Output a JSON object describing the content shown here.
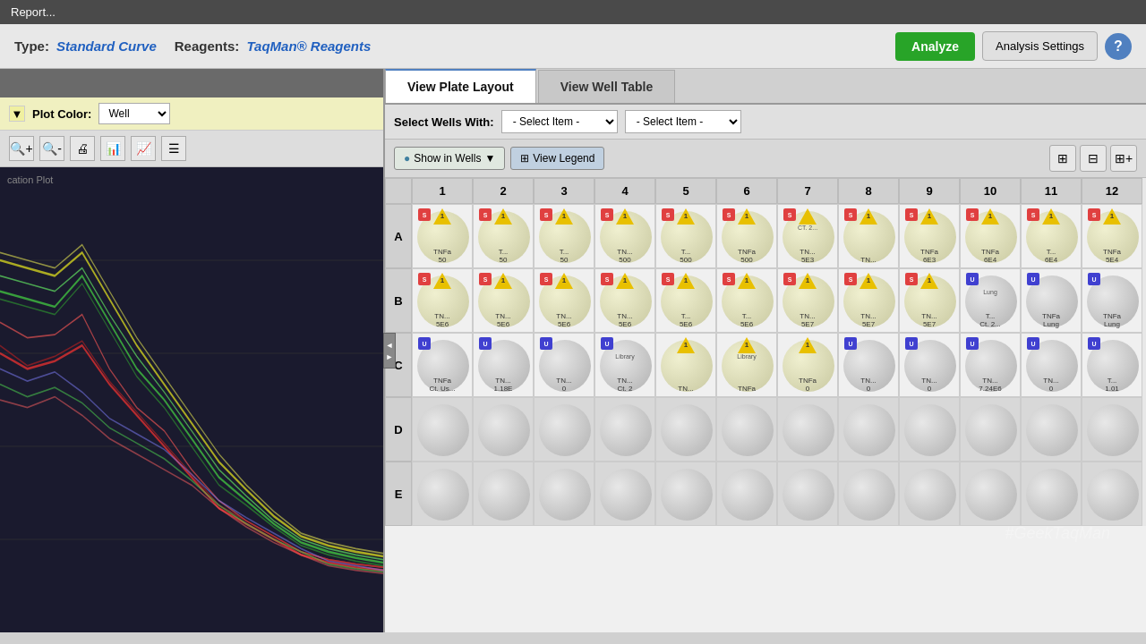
{
  "title_bar": {
    "label": "Report..."
  },
  "top_bar": {
    "type_label": "Type:",
    "type_value": "Standard Curve",
    "reagents_label": "Reagents:",
    "reagents_value": "TaqMan® Reagents",
    "analyze_btn": "Analyze",
    "analysis_settings_btn": "Analysis Settings",
    "help_btn": "?"
  },
  "left_panel": {
    "plot_color_label": "Plot Color:",
    "plot_color_value": "Well",
    "chart_label": "cation Plot"
  },
  "tabs": [
    {
      "id": "plate-layout",
      "label": "View Plate Layout",
      "active": true
    },
    {
      "id": "well-table",
      "label": "View Well Table",
      "active": false
    }
  ],
  "wells_toolbar": {
    "select_wells_label": "Select Wells With:",
    "dropdown1_label": "- Select Item -",
    "dropdown2_label": "- Select Item -"
  },
  "plate_toolbar": {
    "show_in_wells_label": "Show in Wells",
    "view_legend_label": "View Legend"
  },
  "plate": {
    "columns": [
      "1",
      "2",
      "3",
      "4",
      "5",
      "6",
      "7",
      "8",
      "9",
      "10",
      "11",
      "12"
    ],
    "rows": [
      "A",
      "B",
      "C",
      "D",
      "E"
    ],
    "row_A": [
      {
        "num": "1",
        "badge": "S",
        "text": "TNFa\n50",
        "type": "yellow"
      },
      {
        "num": "1",
        "badge": "S",
        "text": "T...\n50",
        "type": "yellow"
      },
      {
        "num": "1",
        "badge": "S",
        "text": "T...\n50",
        "type": "yellow"
      },
      {
        "num": "1",
        "badge": "S",
        "text": "TN...\n500",
        "type": "yellow"
      },
      {
        "num": "1",
        "badge": "S",
        "text": "T...\n500",
        "type": "yellow"
      },
      {
        "num": "1",
        "badge": "S",
        "text": "TNFa\n500",
        "type": "yellow"
      },
      {
        "num": "",
        "badge": "S",
        "text": "TN...\n5E3",
        "type": "special",
        "extra": "CT. 2..."
      },
      {
        "num": "1",
        "badge": "S",
        "text": "TN...\n",
        "type": "yellow"
      },
      {
        "num": "1",
        "badge": "S",
        "text": "TNFa\n6E3",
        "type": "yellow"
      },
      {
        "num": "1",
        "badge": "S",
        "text": "TNFa\n6E4",
        "type": "yellow"
      },
      {
        "num": "1",
        "badge": "S",
        "text": "T...\n6E4",
        "type": "yellow"
      },
      {
        "num": "1",
        "badge": "S",
        "text": "TNFa\n5E4",
        "type": "yellow"
      }
    ],
    "row_B": [
      {
        "num": "1",
        "badge": "S",
        "text": "TN...\n5E6",
        "type": "yellow"
      },
      {
        "num": "1",
        "badge": "S",
        "text": "TN...\n5E6",
        "type": "yellow"
      },
      {
        "num": "1",
        "badge": "S",
        "text": "TN...\n5E6",
        "type": "yellow"
      },
      {
        "num": "1",
        "badge": "S",
        "text": "TN...\n5E6",
        "type": "yellow"
      },
      {
        "num": "1",
        "badge": "S",
        "text": "T...\n5E6",
        "type": "yellow"
      },
      {
        "num": "1",
        "badge": "S",
        "text": "T...\n5E6",
        "type": "yellow"
      },
      {
        "num": "1",
        "badge": "S",
        "text": "TN...\n5E7",
        "type": "yellow"
      },
      {
        "num": "1",
        "badge": "S",
        "text": "TN...\n5E7",
        "type": "yellow"
      },
      {
        "num": "1",
        "badge": "S",
        "text": "TN...\n5E7",
        "type": "yellow"
      },
      {
        "num": "",
        "badge": "U",
        "text": "T...\nCt. 2...",
        "type": "gray",
        "extra": "Lung"
      },
      {
        "num": "",
        "badge": "U",
        "text": "TNFa\nLung",
        "type": "gray"
      },
      {
        "num": "",
        "badge": "U",
        "text": "TNFa\nLung",
        "type": "gray"
      }
    ],
    "row_C": [
      {
        "num": "",
        "badge": "U",
        "text": "TNFa\nCt. Us...",
        "type": "gray",
        "extra": ""
      },
      {
        "num": "",
        "badge": "U",
        "text": "TN...\n1.18E",
        "type": "gray"
      },
      {
        "num": "",
        "badge": "U",
        "text": "TN...\n0",
        "type": "gray"
      },
      {
        "num": "",
        "badge": "U",
        "text": "TN...\nCt. 2",
        "type": "gray",
        "extra": "Library"
      },
      {
        "num": "1",
        "badge": "",
        "text": "TN...\n",
        "type": "yellow"
      },
      {
        "num": "1",
        "badge": "",
        "text": "TNFa\n",
        "type": "yellow",
        "extra": "Library"
      },
      {
        "num": "1",
        "badge": "",
        "text": "TNFa\n0",
        "type": "yellow"
      },
      {
        "num": "",
        "badge": "U",
        "text": "TN...\n0",
        "type": "gray"
      },
      {
        "num": "",
        "badge": "U",
        "text": "TN...\n0",
        "type": "gray"
      },
      {
        "num": "",
        "badge": "U",
        "text": "TN...\n7.24E6",
        "type": "gray"
      },
      {
        "num": "",
        "badge": "U",
        "text": "TN...\n0",
        "type": "gray"
      },
      {
        "num": "",
        "badge": "U",
        "text": "T...\n1.01",
        "type": "gray"
      }
    ],
    "row_D": [
      {
        "empty": true
      },
      {
        "empty": true
      },
      {
        "empty": true
      },
      {
        "empty": true
      },
      {
        "empty": true
      },
      {
        "empty": true
      },
      {
        "empty": true
      },
      {
        "empty": true
      },
      {
        "empty": true
      },
      {
        "empty": true
      },
      {
        "empty": true
      },
      {
        "empty": true
      }
    ],
    "row_E": [
      {
        "empty": true
      },
      {
        "empty": true
      },
      {
        "empty": true
      },
      {
        "empty": true
      },
      {
        "empty": true
      },
      {
        "empty": true
      },
      {
        "empty": true
      },
      {
        "empty": true
      },
      {
        "empty": true
      },
      {
        "empty": true
      },
      {
        "empty": true
      },
      {
        "empty": true
      }
    ]
  },
  "watermark": "#GeekTaqMan"
}
